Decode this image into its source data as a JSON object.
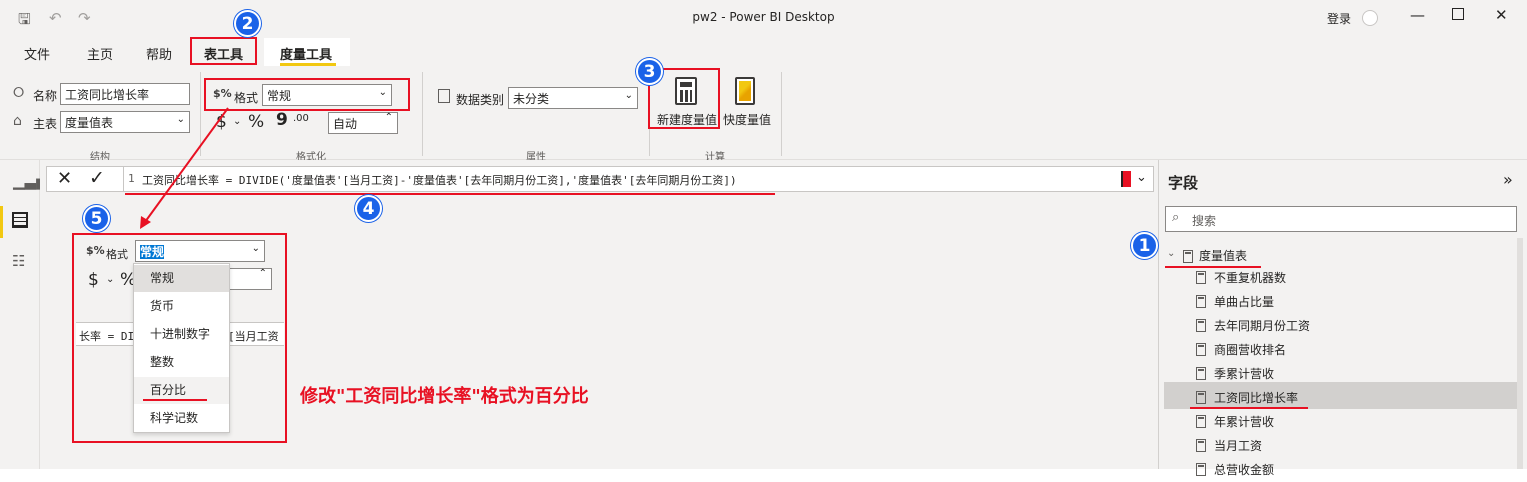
{
  "window": {
    "title": "pw2 - Power BI Desktop",
    "signin": "登录"
  },
  "tabs": [
    "文件",
    "主页",
    "帮助",
    "表工具",
    "度量工具"
  ],
  "ribbon": {
    "structure": {
      "name_label": "名称",
      "name_value": "工资同比增长率",
      "home_table_label": "主表",
      "home_table_value": "度量值表",
      "group": "结构"
    },
    "formatting": {
      "format_label": "格式",
      "format_value": "常规",
      "currency_symbol": "$",
      "percent_symbol": "%",
      "comma_symbol": "9",
      "decimal_symbol": ".00",
      "decimals_value": "自动",
      "group": "格式化"
    },
    "properties": {
      "data_category_label": "数据类别",
      "data_category_value": "未分类",
      "group": "属性"
    },
    "calculations": {
      "new_measure": "新建度量值",
      "quick_measure": "快度量值",
      "group": "计算"
    }
  },
  "formula": {
    "line_number": "1",
    "text": "工资同比增长率 = DIVIDE('度量值表'[当月工资]-'度量值表'[去年同期月份工资],'度量值表'[去年同期月份工资])"
  },
  "zoom_inset": {
    "format_label": "格式",
    "format_value": "常规",
    "currency_symbol": "$",
    "percent_symbol": "%",
    "options": [
      "常规",
      "货币",
      "十进制数字",
      "整数",
      "百分比",
      "科学记数"
    ],
    "formula_fragment_left": "长率 = DIV",
    "formula_fragment_right": "[当月工资"
  },
  "annotation": {
    "text": "修改\"工资同比增长率\"格式为百分比",
    "badges": [
      "1",
      "2",
      "3",
      "4",
      "5"
    ],
    "color": "#e81123",
    "badge_color": "#1a62e8"
  },
  "fields_pane": {
    "title": "字段",
    "search_placeholder": "搜索",
    "table_name": "度量值表",
    "items": [
      "不重复机器数",
      "单曲占比量",
      "去年同期月份工资",
      "商圈营收排名",
      "季累计营收",
      "工资同比增长率",
      "年累计营收",
      "当月工资",
      "总营收金额"
    ]
  }
}
